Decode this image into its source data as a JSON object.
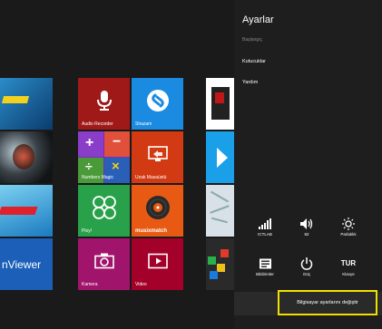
{
  "start_screen": {
    "tiles": {
      "audio_recorder": {
        "label": "Audio Recorder",
        "color": "#a01919"
      },
      "shazam": {
        "label": "Shazam",
        "color": "#1a8be0"
      },
      "numbers": {
        "label": "Numbers Magic",
        "color": "#7a2db8"
      },
      "remote_desktop": {
        "label": "Uzak Masaüstü",
        "color": "#d13a12"
      },
      "ploy": {
        "label": "Ploy!",
        "color": "#29a04a"
      },
      "musixmatch": {
        "label": "musixmatch",
        "color": "#e85a14"
      },
      "camera": {
        "label": "Kamera",
        "color": "#a0156b"
      },
      "video": {
        "label": "Video",
        "color": "#a3002a"
      },
      "viewer": {
        "label": "nViewer",
        "color": "#1b5fb8"
      }
    }
  },
  "settings_charm": {
    "title": "Ayarlar",
    "subtitle": "Başlangıç",
    "links": [
      "Kutucuklar",
      "Yardım"
    ],
    "quick_settings": [
      {
        "icon": "network-icon",
        "label": "ICTLAB"
      },
      {
        "icon": "volume-icon",
        "label": "82"
      },
      {
        "icon": "brightness-icon",
        "label": "Parlaklık"
      },
      {
        "icon": "notifications-icon",
        "label": "Bildirimler"
      },
      {
        "icon": "power-icon",
        "label": "Güç"
      },
      {
        "icon": "keyboard-icon",
        "label": "Klavye",
        "value": "TUR"
      }
    ],
    "change_pc_settings": "Bilgisayar ayarlarını değiştir",
    "highlight_color": "#f0e000"
  }
}
